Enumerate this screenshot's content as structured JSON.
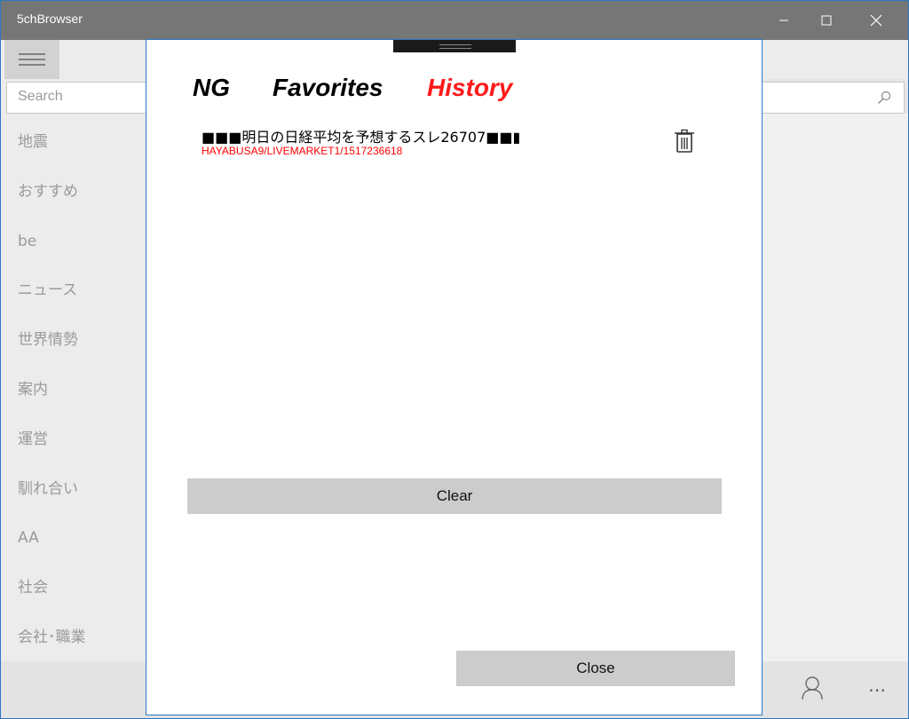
{
  "window": {
    "title": "5chBrowser",
    "accent_color": "#2b78c6"
  },
  "search": {
    "placeholder": "Search"
  },
  "sidebar": {
    "items": [
      {
        "label": "地震"
      },
      {
        "label": "おすすめ"
      },
      {
        "label": "be"
      },
      {
        "label": "ニュース"
      },
      {
        "label": "世界情勢"
      },
      {
        "label": "案内"
      },
      {
        "label": "運営"
      },
      {
        "label": "馴れ合い"
      },
      {
        "label": "AA"
      },
      {
        "label": "社会"
      },
      {
        "label": "会社･職業"
      }
    ]
  },
  "dialog": {
    "tabs": [
      {
        "label": "NG",
        "active": false
      },
      {
        "label": "Favorites",
        "active": false
      },
      {
        "label": "History",
        "active": true
      }
    ],
    "active_tab_color": "#ff1a1a",
    "history": [
      {
        "title": "■■■明日の日経平均を予想するスレ26707■■▮",
        "subtitle": "HAYABUSA9/LIVEMARKET1/1517236618",
        "action_icon": "trash-icon"
      }
    ],
    "clear_label": "Clear",
    "close_label": "Close"
  },
  "icons": [
    "hamburger-icon",
    "search-icon",
    "user-icon",
    "more-icon",
    "trash-icon",
    "minimize-icon",
    "maximize-icon",
    "close-icon"
  ]
}
